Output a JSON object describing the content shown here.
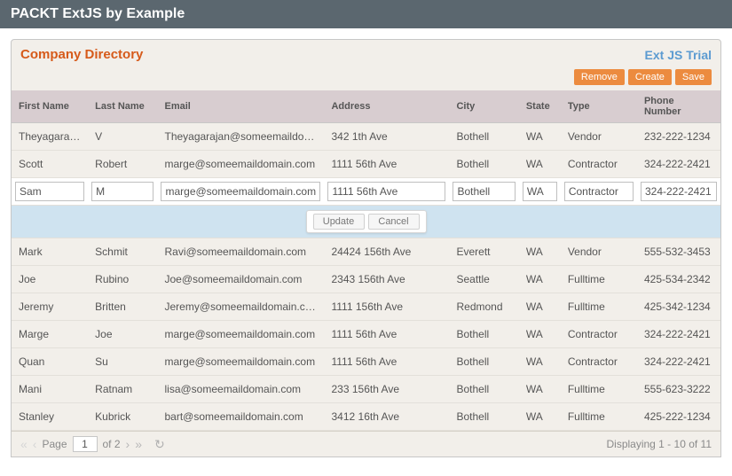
{
  "appTitle": "PACKT ExtJS by Example",
  "panelTitle": "Company Directory",
  "trialLabel": "Ext JS Trial",
  "buttons": {
    "remove": "Remove",
    "create": "Create",
    "save": "Save"
  },
  "columns": {
    "first": "First Name",
    "last": "Last Name",
    "email": "Email",
    "address": "Address",
    "city": "City",
    "state": "State",
    "type": "Type",
    "phone": "Phone Number"
  },
  "rows": [
    {
      "first": "Theyagarajan",
      "last": "V",
      "email": "Theyagarajan@someemaildomain.com",
      "address": "342 1th Ave",
      "city": "Bothell",
      "state": "WA",
      "type": "Vendor",
      "phone": "232-222-1234"
    },
    {
      "first": "Scott",
      "last": "Robert",
      "email": "marge@someemaildomain.com",
      "address": "1111 56th Ave",
      "city": "Bothell",
      "state": "WA",
      "type": "Contractor",
      "phone": "324-222-2421"
    }
  ],
  "editRow": {
    "first": "Sam",
    "last": "M",
    "email": "marge@someemaildomain.com",
    "address": "1111 56th Ave",
    "city": "Bothell",
    "state": "WA",
    "type": "Contractor",
    "phone": "324-222-2421"
  },
  "editActions": {
    "update": "Update",
    "cancel": "Cancel"
  },
  "rowsAfter": [
    {
      "first": "Mark",
      "last": "Schmit",
      "email": "Ravi@someemaildomain.com",
      "address": "24424 156th Ave",
      "city": "Everett",
      "state": "WA",
      "type": "Vendor",
      "phone": "555-532-3453"
    },
    {
      "first": "Joe",
      "last": "Rubino",
      "email": "Joe@someemaildomain.com",
      "address": "2343 156th Ave",
      "city": "Seattle",
      "state": "WA",
      "type": "Fulltime",
      "phone": "425-534-2342"
    },
    {
      "first": "Jeremy",
      "last": "Britten",
      "email": "Jeremy@someemaildomain.com",
      "address": "1111 156th Ave",
      "city": "Redmond",
      "state": "WA",
      "type": "Fulltime",
      "phone": "425-342-1234"
    },
    {
      "first": "Marge",
      "last": "Joe",
      "email": "marge@someemaildomain.com",
      "address": "1111 56th Ave",
      "city": "Bothell",
      "state": "WA",
      "type": "Contractor",
      "phone": "324-222-2421"
    },
    {
      "first": "Quan",
      "last": "Su",
      "email": "marge@someemaildomain.com",
      "address": "1111 56th Ave",
      "city": "Bothell",
      "state": "WA",
      "type": "Contractor",
      "phone": "324-222-2421"
    },
    {
      "first": "Mani",
      "last": "Ratnam",
      "email": "lisa@someemaildomain.com",
      "address": "233 156th Ave",
      "city": "Bothell",
      "state": "WA",
      "type": "Fulltime",
      "phone": "555-623-3222"
    },
    {
      "first": "Stanley",
      "last": "Kubrick",
      "email": "bart@someemaildomain.com",
      "address": "3412 16th Ave",
      "city": "Bothell",
      "state": "WA",
      "type": "Fulltime",
      "phone": "425-222-1234"
    }
  ],
  "pager": {
    "pageLabel": "Page",
    "current": "1",
    "ofLabel": "of 2",
    "displaying": "Displaying 1 - 10 of 11"
  }
}
